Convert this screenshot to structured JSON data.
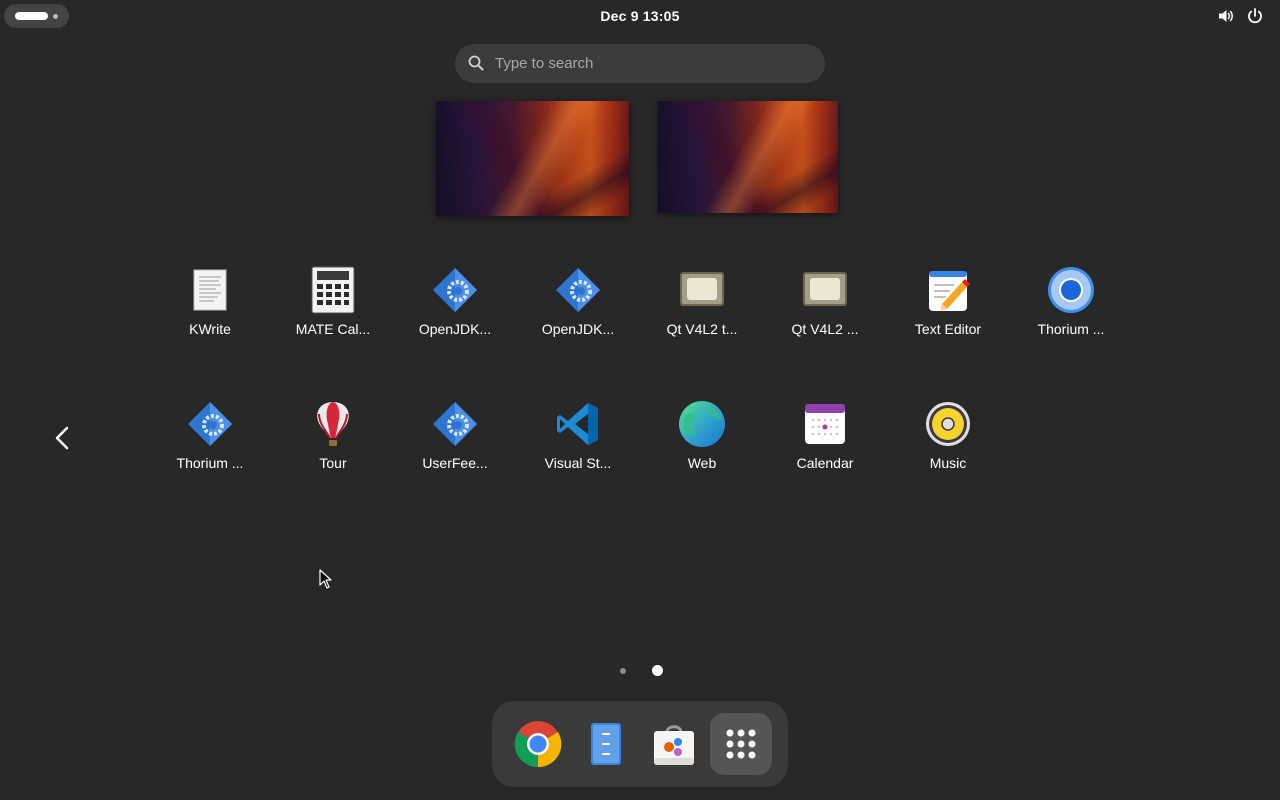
{
  "top_bar": {
    "clock": "Dec 9  13:05",
    "icons": [
      "activities-indicator",
      "volume-icon",
      "power-icon"
    ]
  },
  "search": {
    "placeholder": "Type to search"
  },
  "workspaces": [
    "workspace-1",
    "workspace-2"
  ],
  "app_grid": {
    "row1": [
      {
        "label": "KWrite",
        "icon": "kwrite-icon"
      },
      {
        "label": "MATE Cal...",
        "icon": "calculator-icon"
      },
      {
        "label": "OpenJDK...",
        "icon": "java-gear-icon"
      },
      {
        "label": "OpenJDK...",
        "icon": "java-gear-icon"
      },
      {
        "label": "Qt V4L2 t...",
        "icon": "webcam-icon"
      },
      {
        "label": "Qt V4L2 ...",
        "icon": "webcam-icon"
      },
      {
        "label": "Text Editor",
        "icon": "text-editor-icon"
      },
      {
        "label": "Thorium ...",
        "icon": "thorium-browser-icon"
      }
    ],
    "row2": [
      {
        "label": "Thorium ...",
        "icon": "java-gear-icon"
      },
      {
        "label": "Tour",
        "icon": "balloon-icon"
      },
      {
        "label": "UserFee...",
        "icon": "java-gear-icon"
      },
      {
        "label": "Visual St...",
        "icon": "vscode-icon"
      },
      {
        "label": "Web",
        "icon": "globe-icon"
      },
      {
        "label": "Calendar",
        "icon": "calendar-icon"
      },
      {
        "label": "Music",
        "icon": "music-speaker-icon"
      }
    ]
  },
  "pagination": {
    "pages": 2,
    "current": 2
  },
  "dash": [
    {
      "name": "Google Chrome",
      "icon": "chrome-icon"
    },
    {
      "name": "Files",
      "icon": "files-icon"
    },
    {
      "name": "Software",
      "icon": "software-store-icon"
    },
    {
      "name": "Show Apps",
      "icon": "app-grid-icon",
      "active": true
    }
  ],
  "colors": {
    "background": "#282828",
    "panel": "#3a3a3a",
    "accent_blue": "#3584e4"
  }
}
